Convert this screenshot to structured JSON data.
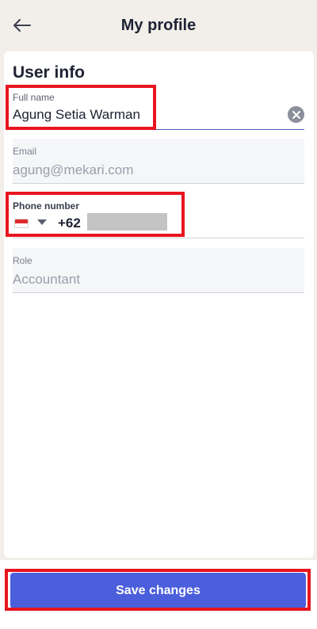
{
  "header": {
    "title": "My profile",
    "back_icon": "arrow-left-icon"
  },
  "user_info": {
    "section_title": "User info",
    "full_name": {
      "label": "Full name",
      "value": "Agung Setia Warman",
      "clear_icon": "clear-circle-icon"
    },
    "email": {
      "label": "Email",
      "value": "agung@mekari.com"
    },
    "phone": {
      "label": "Phone number",
      "country_flag": "indonesia-flag-icon",
      "dial_code": "+62"
    },
    "role": {
      "label": "Role",
      "value": "Accountant"
    }
  },
  "footer": {
    "save_label": "Save changes"
  },
  "colors": {
    "primary": "#4b5edc",
    "highlight": "#e8151f",
    "background": "#f2efea"
  }
}
